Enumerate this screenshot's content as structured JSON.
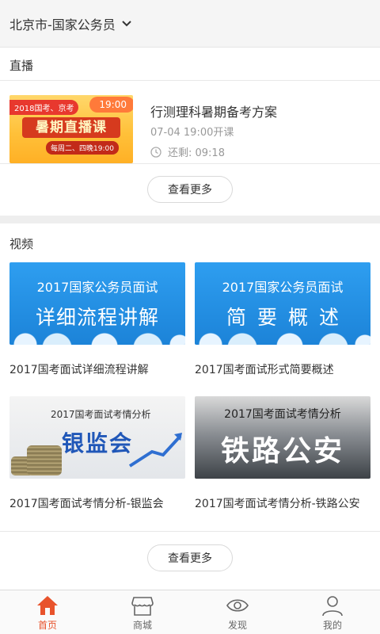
{
  "header": {
    "location": "北京市-国家公务员"
  },
  "live": {
    "section_title": "直播",
    "card": {
      "thumb_tag": "2018国考、京考",
      "thumb_time": "19:00",
      "thumb_banner": "暑期直播课",
      "thumb_sub": "每周二、四晚19:00",
      "title": "行测理科暑期备考方案",
      "date": "07-04 19:00开课",
      "remain": "还剩:  09:18"
    },
    "more_label": "查看更多"
  },
  "video": {
    "section_title": "视频",
    "items": [
      {
        "thumb_line1": "2017国家公务员面试",
        "thumb_line2": "详细流程讲解",
        "caption": "2017国考面试详细流程讲解"
      },
      {
        "thumb_line1": "2017国家公务员面试",
        "thumb_line2": "简要概述",
        "caption": "2017国考面试形式简要概述"
      },
      {
        "thumb_line1": "2017国考面试考情分析",
        "thumb_line2": "银监会",
        "caption": "2017国考面试考情分析-银监会"
      },
      {
        "thumb_line1": "2017国考面试考情分析",
        "thumb_line2": "铁路公安",
        "caption": "2017国考面试考情分析-铁路公安"
      }
    ],
    "more_label": "查看更多"
  },
  "nav": {
    "items": [
      {
        "label": "首页",
        "icon": "home-icon",
        "active": true
      },
      {
        "label": "商城",
        "icon": "store-icon",
        "active": false
      },
      {
        "label": "发现",
        "icon": "eye-icon",
        "active": false
      },
      {
        "label": "我的",
        "icon": "user-icon",
        "active": false
      }
    ],
    "active_color": "#e8532c"
  }
}
